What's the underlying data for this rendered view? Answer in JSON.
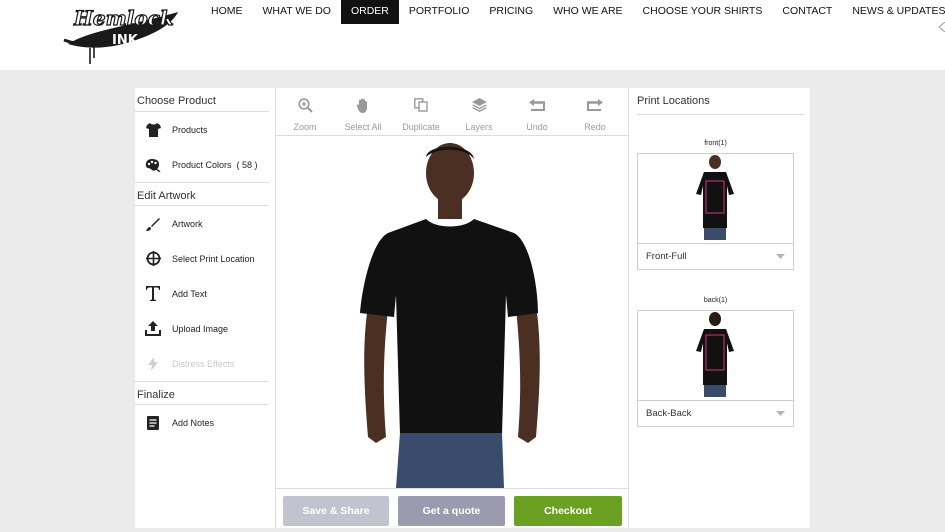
{
  "brand": {
    "name": "Hemlock",
    "sub": "INK"
  },
  "nav": [
    {
      "label": "HOME",
      "active": false
    },
    {
      "label": "WHAT WE DO",
      "active": false
    },
    {
      "label": "ORDER",
      "active": true
    },
    {
      "label": "PORTFOLIO",
      "active": false
    },
    {
      "label": "PRICING",
      "active": false
    },
    {
      "label": "WHO WE ARE",
      "active": false
    },
    {
      "label": "CHOOSE YOUR SHIRTS",
      "active": false
    },
    {
      "label": "CONTACT",
      "active": false
    },
    {
      "label": "NEWS & UPDATES",
      "active": false
    }
  ],
  "sidebar": {
    "choose_product": "Choose Product",
    "products": "Products",
    "product_colors": "Product Colors",
    "product_colors_count": "( 58 )",
    "edit_artwork": "Edit Artwork",
    "artwork": "Artwork",
    "select_print_location": "Select Print Location",
    "add_text": "Add Text",
    "upload_image": "Upload Image",
    "distress_effects": "Distress Effects",
    "finalize": "Finalize",
    "add_notes": "Add Notes"
  },
  "toolbar": {
    "zoom": "Zoom",
    "select_all": "Select All",
    "duplicate": "Duplicate",
    "layers": "Layers",
    "undo": "Undo",
    "redo": "Redo"
  },
  "actions": {
    "save_share": "Save & Share",
    "get_quote": "Get a quote",
    "checkout": "Checkout"
  },
  "print_locations": {
    "title": "Print Locations",
    "front_label": "front(1)",
    "front_value": "Front-Full",
    "back_label": "back(1)",
    "back_value": "Back-Back"
  },
  "colors": {
    "nav_active": "#111111",
    "checkout": "#6aa121",
    "quote": "#9b9aae",
    "share": "#c2c3cf",
    "print_area": "#d63384"
  }
}
